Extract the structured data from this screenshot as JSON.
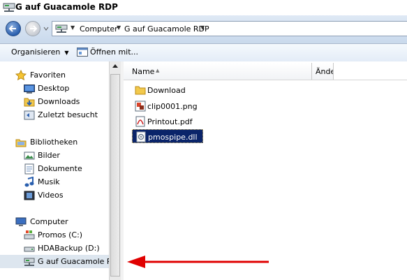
{
  "window": {
    "title": "G auf Guacamole RDP"
  },
  "address": {
    "crumbs": [
      "Computer",
      "G auf Guacamole RDP"
    ]
  },
  "toolbar": {
    "organize_label": "Organisieren",
    "open_with_label": "Öffnen mit..."
  },
  "nav": {
    "favorites": {
      "label": "Favoriten",
      "items": [
        {
          "label": "Desktop",
          "icon": "desktop-icon"
        },
        {
          "label": "Downloads",
          "icon": "downloads-folder-icon"
        },
        {
          "label": "Zuletzt besucht",
          "icon": "recent-places-icon"
        }
      ]
    },
    "libraries": {
      "label": "Bibliotheken",
      "items": [
        {
          "label": "Bilder",
          "icon": "pictures-icon"
        },
        {
          "label": "Dokumente",
          "icon": "documents-icon"
        },
        {
          "label": "Musik",
          "icon": "music-icon"
        },
        {
          "label": "Videos",
          "icon": "videos-icon"
        }
      ]
    },
    "computer": {
      "label": "Computer",
      "items": [
        {
          "label": "Promos (C:)",
          "icon": "system-drive-icon"
        },
        {
          "label": "HDABackup (D:)",
          "icon": "drive-icon"
        },
        {
          "label": "G auf Guacamole RDP",
          "icon": "network-drive-icon",
          "selected": true
        }
      ]
    }
  },
  "files": {
    "columns": {
      "name": "Name",
      "changed": "Ände"
    },
    "items": [
      {
        "label": "Download",
        "icon": "folder-icon"
      },
      {
        "label": "clip0001.png",
        "icon": "png-file-icon"
      },
      {
        "label": "Printout.pdf",
        "icon": "pdf-file-icon"
      },
      {
        "label": "pmospipe.dll",
        "icon": "dll-file-icon",
        "selected": true
      }
    ]
  },
  "colors": {
    "selection": "#0a246a",
    "annotation_arrow": "#e00000",
    "toolbar_bg": "#e3ecf7"
  }
}
